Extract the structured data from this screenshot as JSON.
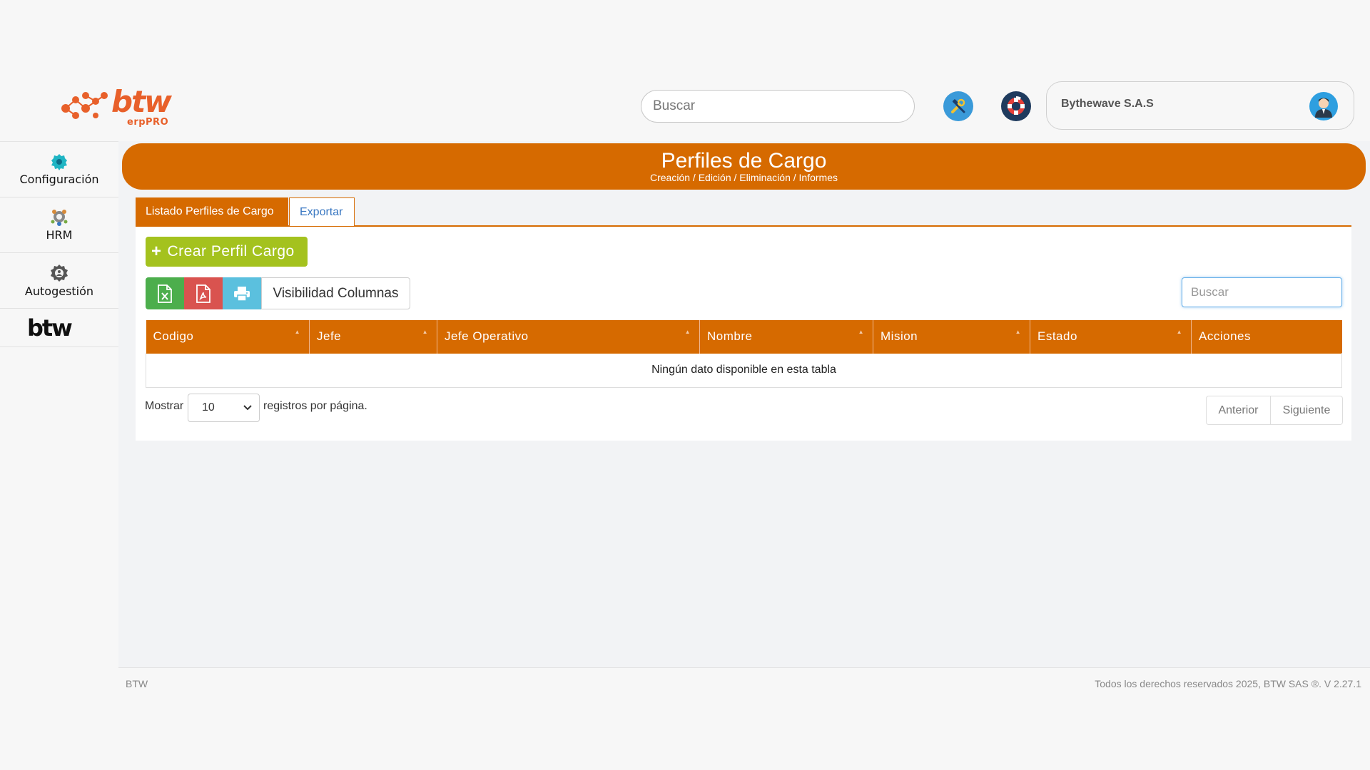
{
  "header": {
    "logo_text": "btw",
    "logo_sub": "erpPRO",
    "search_placeholder": "Buscar",
    "company_name": "Bythewave S.A.S"
  },
  "sidebar": {
    "items": [
      {
        "label": "Configuración",
        "icon": "gear-icon"
      },
      {
        "label": "HRM",
        "icon": "people-icon"
      },
      {
        "label": "Autogestión",
        "icon": "self-service-gear-icon"
      }
    ],
    "brand": "btw"
  },
  "page": {
    "title": "Perfiles de Cargo",
    "subtitle": "Creación / Edición / Eliminación / Informes"
  },
  "tabs": [
    {
      "label": "Listado Perfiles de Cargo",
      "active": true
    },
    {
      "label": "Exportar",
      "active": false
    }
  ],
  "toolbar": {
    "create_label": "Crear Perfil Cargo",
    "columns_label": "Visibilidad Columnas",
    "search_placeholder": "Buscar"
  },
  "table": {
    "columns": [
      "Codigo",
      "Jefe",
      "Jefe Operativo",
      "Nombre",
      "Mision",
      "Estado",
      "Acciones"
    ],
    "empty_message": "Ningún dato disponible en esta tabla"
  },
  "pagination": {
    "show_label": "Mostrar",
    "page_size": "10",
    "suffix_label": "registros por página.",
    "prev_label": "Anterior",
    "next_label": "Siguiente"
  },
  "footer": {
    "left": "BTW",
    "right": "Todos los derechos reservados 2025, BTW SAS ®. V 2.27.1"
  },
  "colors": {
    "primary": "#d66a00",
    "create_button": "#a4c21e",
    "excel": "#4cae4c",
    "pdf": "#d9534f",
    "print": "#5bc0de"
  }
}
